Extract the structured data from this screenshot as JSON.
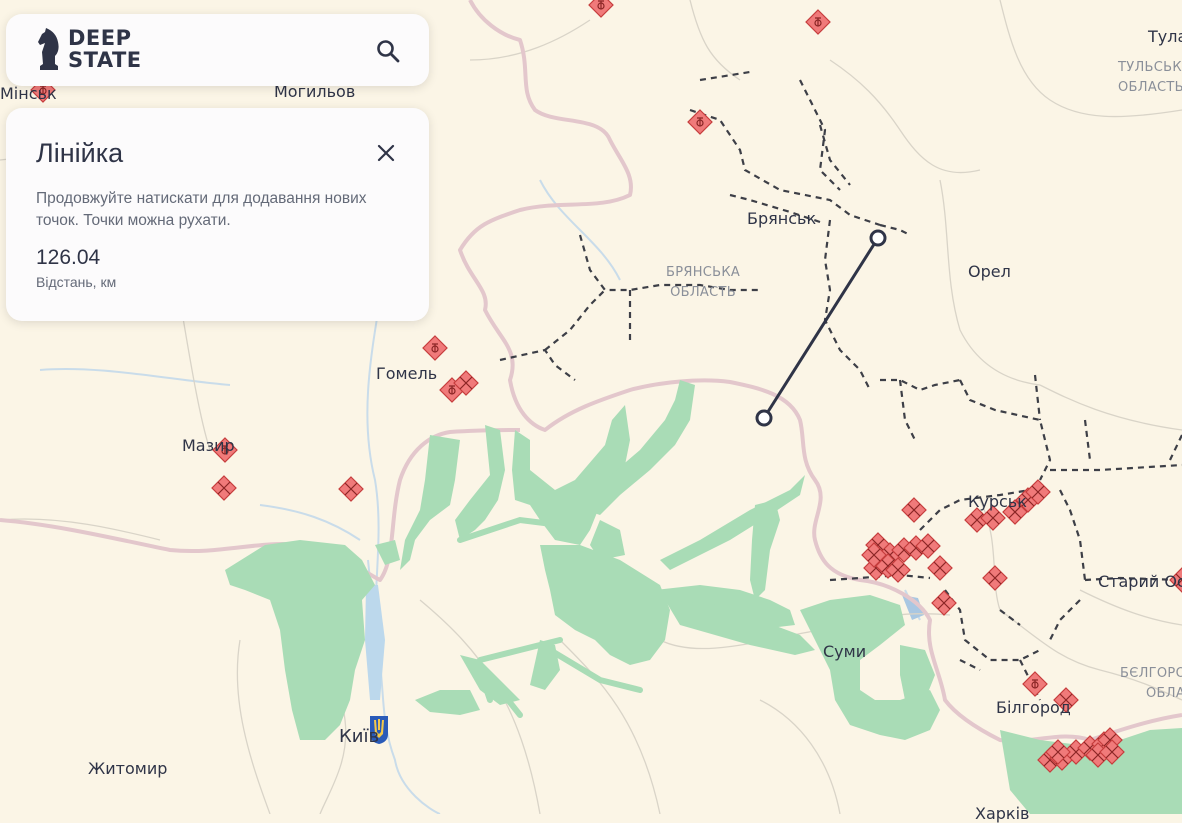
{
  "app": {
    "logo_line1": "DEEP",
    "logo_line2": "STATE"
  },
  "ruler": {
    "title": "Лінійка",
    "description": "Продовжуйте натискати для додавання нових точок. Точки можна рухати.",
    "distance": "126.04",
    "distance_label": "Відстань, км"
  },
  "cities": {
    "tula": "Тула",
    "minsk": "Мінськ",
    "mogilev": "Могильов",
    "bryansk": "Брянськ",
    "orel": "Орел",
    "gomel": "Гомель",
    "mazyr": "Мазир",
    "kursk": "Курськ",
    "stary_oskol": "Старий Оскол",
    "sumy": "Суми",
    "kyiv": "Київ",
    "zhytomyr": "Житомир",
    "belgorod": "Білгород",
    "kharkiv": "Харків"
  },
  "regions": {
    "tula_line1": "ТУЛЬСЬКА",
    "tula_line2": "ОБЛАСТЬ",
    "bryansk_line1": "БРЯНСЬКА",
    "bryansk_line2": "ОБЛАСТЬ",
    "belgorod_line1": "БЄЛГОРОДСЬКА",
    "belgorod_line2": "ОБЛАСТЬ"
  },
  "colors": {
    "background": "#fbf5e6",
    "liberated_area": "#a9dcb6",
    "border": "#e3c7cc",
    "marker": "#f07a7a",
    "ruler_line": "#2f3447"
  }
}
